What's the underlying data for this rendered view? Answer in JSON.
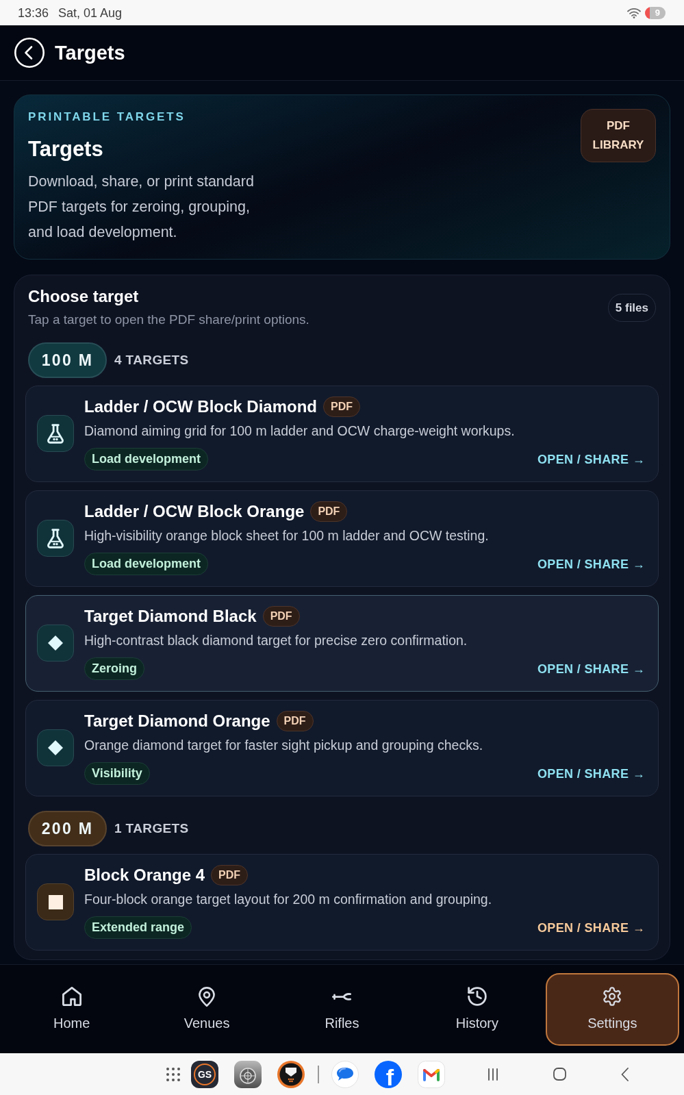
{
  "status_bar": {
    "time": "13:36",
    "date": "Sat, 01 Aug",
    "battery": "9"
  },
  "header": {
    "title": "Targets"
  },
  "hero": {
    "eyebrow": "PRINTABLE TARGETS",
    "title": "Targets",
    "description": "Download, share, or print standard PDF targets for zeroing, grouping, and load development.",
    "button": "PDF LIBRARY"
  },
  "chooser": {
    "title": "Choose target",
    "subtitle": "Tap a target to open the PDF share/print options.",
    "count": "5 files",
    "groups": [
      {
        "distance": "100 M",
        "count": "4 TARGETS",
        "color": "#8ee0f0",
        "targets": [
          {
            "kind": "ladder",
            "title": "Ladder / OCW Block Diamond",
            "badge": "PDF",
            "description": "Diamond aiming grid for 100 m ladder and OCW charge-weight workups.",
            "tag": "Load development",
            "action": "OPEN / SHARE →",
            "selected": false
          },
          {
            "kind": "ladder",
            "title": "Ladder / OCW Block Orange",
            "badge": "PDF",
            "description": "High-visibility orange block sheet for 100 m ladder and OCW testing.",
            "tag": "Load development",
            "action": "OPEN / SHARE →",
            "selected": false
          },
          {
            "kind": "diamond",
            "title": "Target Diamond Black",
            "badge": "PDF",
            "description": "High-contrast black diamond target for precise zero confirmation.",
            "tag": "Zeroing",
            "action": "OPEN / SHARE →",
            "selected": true
          },
          {
            "kind": "diamond",
            "title": "Target Diamond Orange",
            "badge": "PDF",
            "description": "Orange diamond target for faster sight pickup and grouping checks.",
            "tag": "Visibility",
            "action": "OPEN / SHARE →",
            "selected": false
          }
        ]
      },
      {
        "distance": "200 M",
        "count": "1 TARGETS",
        "color": "#f6c99a",
        "targets": [
          {
            "kind": "block",
            "title": "Block Orange 4",
            "badge": "PDF",
            "description": "Four-block orange target layout for 200 m confirmation and grouping.",
            "tag": "Extended range",
            "action": "OPEN / SHARE →",
            "selected": false
          }
        ]
      }
    ]
  },
  "nav": [
    {
      "kind": "home",
      "label": "Home",
      "selected": false
    },
    {
      "kind": "venues",
      "label": "Venues",
      "selected": false
    },
    {
      "kind": "rifles",
      "label": "Rifles",
      "selected": false
    },
    {
      "kind": "history",
      "label": "History",
      "selected": false
    },
    {
      "kind": "settings",
      "label": "Settings",
      "selected": true
    }
  ],
  "system_bar": {
    "pinned_apps": [
      {
        "kind": "gs",
        "label": "GS"
      },
      {
        "kind": "garmin"
      },
      {
        "kind": "shield"
      }
    ],
    "recent_apps": [
      {
        "kind": "messages"
      },
      {
        "kind": "facebook",
        "label": "f"
      },
      {
        "kind": "gmail"
      }
    ]
  }
}
